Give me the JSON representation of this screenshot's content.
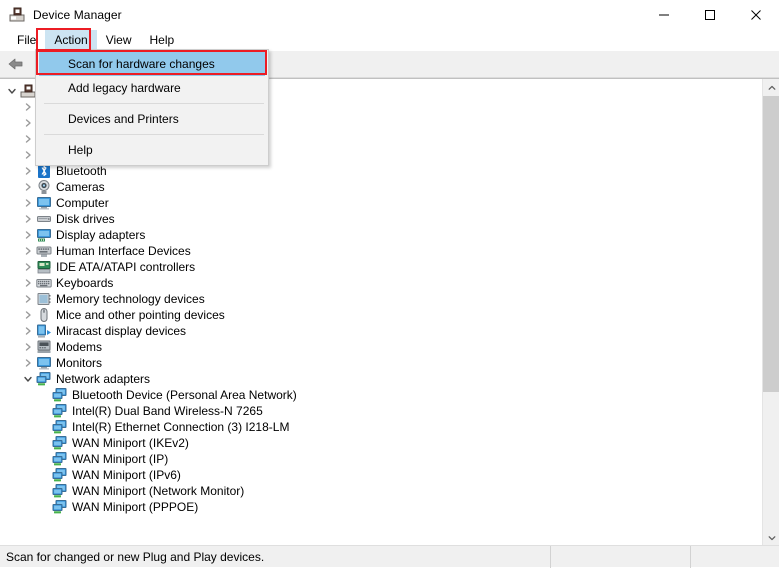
{
  "window": {
    "title": "Device Manager",
    "icon": "device-manager-icon",
    "controls": {
      "minimize": "minimize-icon",
      "maximize": "maximize-icon",
      "close": "close-icon"
    }
  },
  "menubar": {
    "items": [
      {
        "label": "File",
        "active": false
      },
      {
        "label": "Action",
        "active": true
      },
      {
        "label": "View",
        "active": false
      },
      {
        "label": "Help",
        "active": false
      }
    ]
  },
  "toolbar": {
    "buttons": [
      {
        "icon": "back-arrow-icon"
      },
      {
        "icon": "properties-icon"
      }
    ]
  },
  "dropdown": {
    "items": [
      {
        "label": "Scan for hardware changes",
        "highlighted": true,
        "separator_after": false
      },
      {
        "label": "Add legacy hardware",
        "highlighted": false,
        "separator_after": true
      },
      {
        "label": "Devices and Printers",
        "highlighted": false,
        "separator_after": true
      },
      {
        "label": "Help",
        "highlighted": false,
        "separator_after": false
      }
    ]
  },
  "tree": {
    "root": {
      "label": "",
      "icon": "computer-icon",
      "expanded": true
    },
    "items": [
      {
        "label": "",
        "level": 1,
        "icon": "hidden-node-icon",
        "expander": "collapsed"
      },
      {
        "label": "",
        "level": 1,
        "icon": "hidden-node-icon",
        "expander": "collapsed"
      },
      {
        "label": "",
        "level": 1,
        "icon": "hidden-node-icon",
        "expander": "collapsed"
      },
      {
        "label": "",
        "level": 1,
        "icon": "hidden-node-icon",
        "expander": "collapsed"
      },
      {
        "label": "Bluetooth",
        "level": 1,
        "icon": "bluetooth-icon",
        "expander": "collapsed"
      },
      {
        "label": "Cameras",
        "level": 1,
        "icon": "camera-icon",
        "expander": "collapsed"
      },
      {
        "label": "Computer",
        "level": 1,
        "icon": "computer-icon",
        "expander": "collapsed"
      },
      {
        "label": "Disk drives",
        "level": 1,
        "icon": "disk-drive-icon",
        "expander": "collapsed"
      },
      {
        "label": "Display adapters",
        "level": 1,
        "icon": "display-adapter-icon",
        "expander": "collapsed"
      },
      {
        "label": "Human Interface Devices",
        "level": 1,
        "icon": "hid-icon",
        "expander": "collapsed"
      },
      {
        "label": "IDE ATA/ATAPI controllers",
        "level": 1,
        "icon": "ide-controller-icon",
        "expander": "collapsed"
      },
      {
        "label": "Keyboards",
        "level": 1,
        "icon": "keyboard-icon",
        "expander": "collapsed"
      },
      {
        "label": "Memory technology devices",
        "level": 1,
        "icon": "memory-icon",
        "expander": "collapsed"
      },
      {
        "label": "Mice and other pointing devices",
        "level": 1,
        "icon": "mouse-icon",
        "expander": "collapsed"
      },
      {
        "label": "Miracast display devices",
        "level": 1,
        "icon": "miracast-icon",
        "expander": "collapsed"
      },
      {
        "label": "Modems",
        "level": 1,
        "icon": "modem-icon",
        "expander": "collapsed"
      },
      {
        "label": "Monitors",
        "level": 1,
        "icon": "monitor-icon",
        "expander": "collapsed"
      },
      {
        "label": "Network adapters",
        "level": 1,
        "icon": "network-adapter-icon",
        "expander": "expanded"
      },
      {
        "label": "Bluetooth Device (Personal Area Network)",
        "level": 2,
        "icon": "network-adapter-icon",
        "expander": "none"
      },
      {
        "label": "Intel(R) Dual Band Wireless-N 7265",
        "level": 2,
        "icon": "network-adapter-icon",
        "expander": "none"
      },
      {
        "label": "Intel(R) Ethernet Connection (3) I218-LM",
        "level": 2,
        "icon": "network-adapter-icon",
        "expander": "none"
      },
      {
        "label": "WAN Miniport (IKEv2)",
        "level": 2,
        "icon": "network-adapter-icon",
        "expander": "none"
      },
      {
        "label": "WAN Miniport (IP)",
        "level": 2,
        "icon": "network-adapter-icon",
        "expander": "none"
      },
      {
        "label": "WAN Miniport (IPv6)",
        "level": 2,
        "icon": "network-adapter-icon",
        "expander": "none"
      },
      {
        "label": "WAN Miniport (Network Monitor)",
        "level": 2,
        "icon": "network-adapter-icon",
        "expander": "none"
      },
      {
        "label": "WAN Miniport (PPPOE)",
        "level": 2,
        "icon": "network-adapter-icon",
        "expander": "none"
      }
    ]
  },
  "statusbar": {
    "message": "Scan for changed or new Plug and Play devices.",
    "cell2": "",
    "cell3": ""
  },
  "annotations": {
    "accent_color": "#ec1c24",
    "highlight_color": "#91c9ec",
    "menu_active_color": "#cce4f2"
  }
}
